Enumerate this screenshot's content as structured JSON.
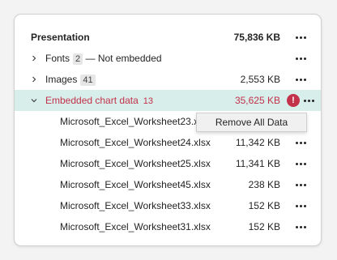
{
  "header": {
    "title": "Presentation",
    "total": "75,836 KB"
  },
  "fonts": {
    "label": "Fonts",
    "count": "2",
    "note": "— Not embedded"
  },
  "images": {
    "label": "Images",
    "count": "41",
    "size": "2,553 KB"
  },
  "embedded": {
    "label": "Embedded chart data",
    "count": "13",
    "size": "35,625 KB",
    "warning": "!"
  },
  "files": [
    {
      "name": "Microsoft_Excel_Worksheet23.xlsx",
      "size": ""
    },
    {
      "name": "Microsoft_Excel_Worksheet24.xlsx",
      "size": "11,342 KB"
    },
    {
      "name": "Microsoft_Excel_Worksheet25.xlsx",
      "size": "11,341 KB"
    },
    {
      "name": "Microsoft_Excel_Worksheet45.xlsx",
      "size": "238 KB"
    },
    {
      "name": "Microsoft_Excel_Worksheet33.xlsx",
      "size": "152 KB"
    },
    {
      "name": "Microsoft_Excel_Worksheet31.xlsx",
      "size": "152 KB"
    }
  ],
  "context_menu": {
    "remove_all_label": "Remove All Data"
  },
  "colors": {
    "warning": "#c4314b",
    "highlight": "#d7eeea"
  }
}
